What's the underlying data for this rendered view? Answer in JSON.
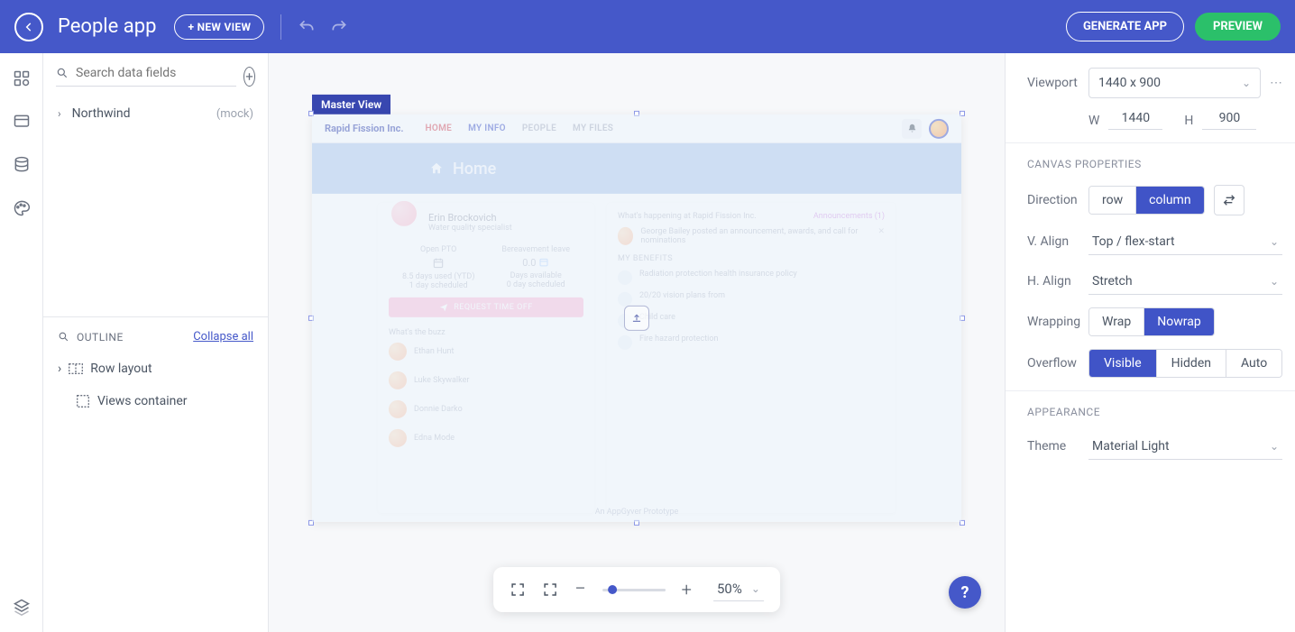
{
  "topbar": {
    "title": "People app",
    "new_view": "+ NEW VIEW",
    "generate": "GENERATE APP",
    "preview": "PREVIEW"
  },
  "left": {
    "search_placeholder": "Search data fields",
    "datasource": {
      "name": "Northwind",
      "suffix": "(mock)"
    },
    "outline_title": "OUTLINE",
    "collapse": "Collapse all",
    "items": [
      {
        "label": "Row layout"
      },
      {
        "label": "Views container"
      }
    ]
  },
  "canvas": {
    "tag": "Master View",
    "mock": {
      "brand": "Rapid Fission Inc.",
      "nav": [
        "HOME",
        "MY INFO",
        "PEOPLE",
        "MY FILES"
      ],
      "home": "Home",
      "profile_name": "Erin Brockovich",
      "profile_role": "Water quality specialist",
      "pto_open": "Open PTO",
      "pto_bereave": "Bereavement leave",
      "pto_val": "0.0",
      "pto_line1": "8.5 days used (YTD)",
      "pto_line1b": "Days available",
      "pto_line2": "1 day scheduled",
      "pto_line2b": "0 day scheduled",
      "req_btn": "REQUEST TIME OFF",
      "buzz_title": "What's the buzz",
      "buzz": [
        "Ethan Hunt",
        "Luke Skywalker",
        "Donnie Darko",
        "Edna Mode"
      ],
      "feed_title": "What's happening at Rapid Fission Inc.",
      "feed_link": "Announcements (1)",
      "feed_item": "George Bailey posted an announcement, awards, and call for nominations",
      "benefits_title": "MY BENEFITS",
      "benefits": [
        "Radiation protection health insurance policy",
        "20/20 vision plans from",
        "Child care",
        "Fire hazard protection"
      ],
      "footer": "An AppGyver Prototype"
    },
    "zoom": "50%"
  },
  "right": {
    "viewport_label": "Viewport",
    "viewport_value": "1440 x 900",
    "w_label": "W",
    "w_value": "1440",
    "h_label": "H",
    "h_value": "900",
    "section1": "CANVAS PROPERTIES",
    "direction_label": "Direction",
    "direction": {
      "row": "row",
      "column": "column"
    },
    "valign_label": "V. Align",
    "valign_value": "Top / flex-start",
    "halign_label": "H. Align",
    "halign_value": "Stretch",
    "wrap_label": "Wrapping",
    "wrap": {
      "wrap": "Wrap",
      "nowrap": "Nowrap"
    },
    "overflow_label": "Overflow",
    "overflow": {
      "visible": "Visible",
      "hidden": "Hidden",
      "auto": "Auto"
    },
    "section2": "APPEARANCE",
    "theme_label": "Theme",
    "theme_value": "Material Light"
  }
}
